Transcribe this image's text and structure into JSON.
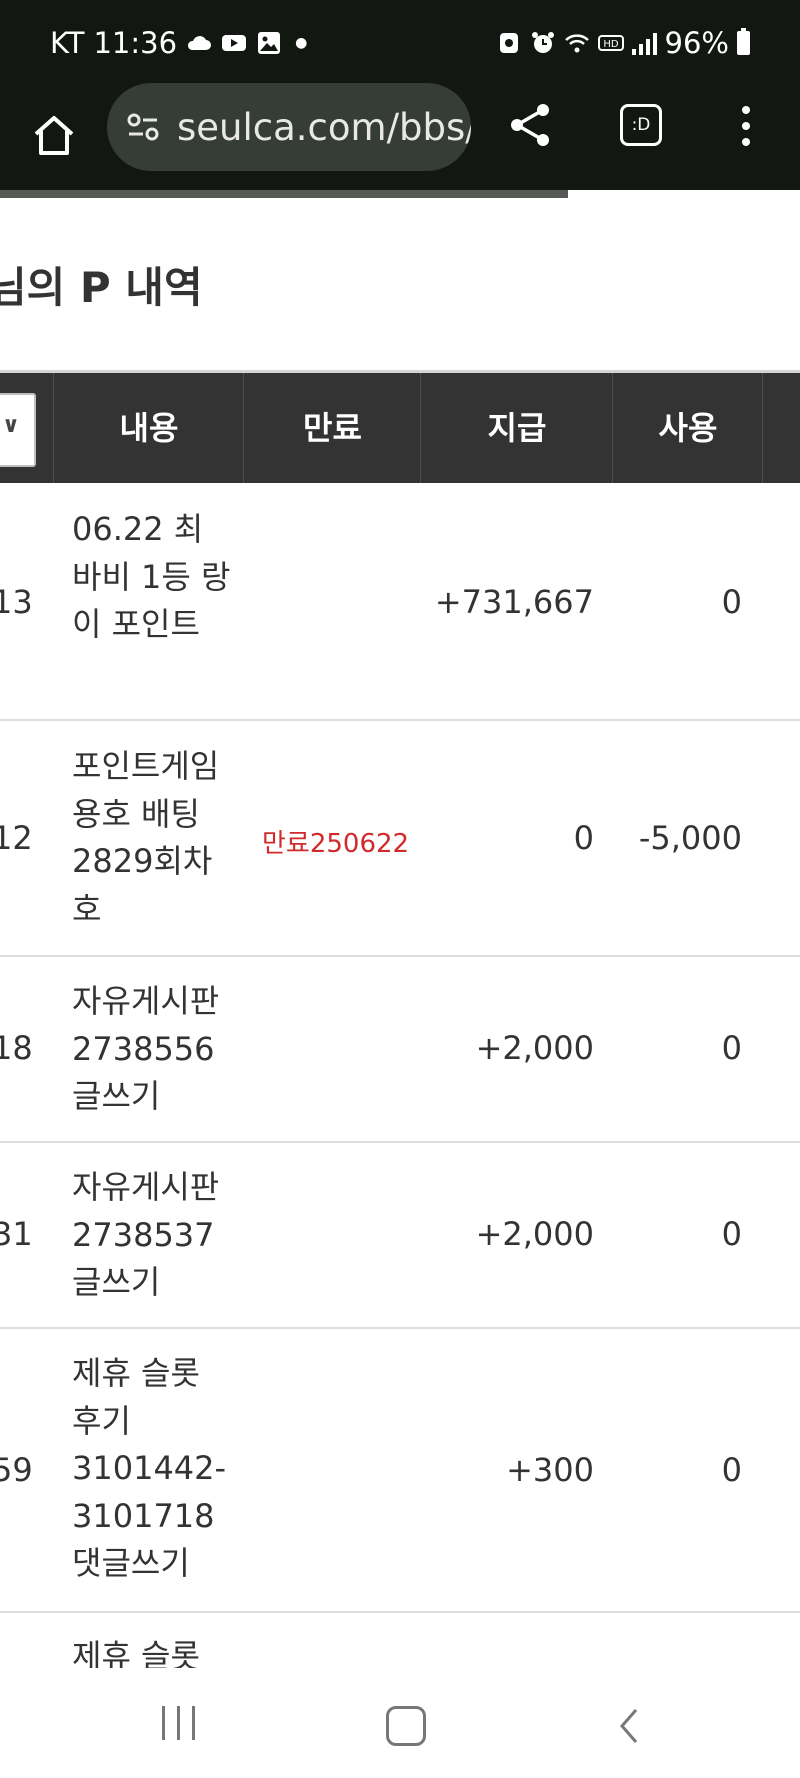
{
  "status_bar": {
    "carrier": "KT",
    "time": "11:36",
    "battery": "96%",
    "icons_left": [
      "cloud-icon",
      "youtube-icon",
      "gallery-icon"
    ],
    "icons_right": [
      "vpn-icon",
      "alarm-icon",
      "wifi-icon",
      "hd-icon",
      "signal-icon",
      "battery-icon"
    ]
  },
  "browser": {
    "url": "seulca.com/bbs/",
    "tabs_label": ":D",
    "page_load_progress": 0.71
  },
  "page": {
    "title": "님의 P 내역"
  },
  "table": {
    "headers": {
      "content": "내용",
      "expire": "만료",
      "pay": "지급",
      "use": "사용"
    },
    "rows": [
      {
        "no": "13",
        "content": "06.22 최바비 1등 랑이 포인트",
        "expire": "",
        "pay": "+731,667",
        "use": "0"
      },
      {
        "no": "12",
        "content": "포인트게임 용호 배팅 2829회차 호",
        "expire": "만료250622",
        "pay": "0",
        "use": "-5,000"
      },
      {
        "no": "18",
        "content": "자유게시판 2738556 글쓰기",
        "expire": "",
        "pay": "+2,000",
        "use": "0"
      },
      {
        "no": "31",
        "content": "자유게시판 2738537 글쓰기",
        "expire": "",
        "pay": "+2,000",
        "use": "0"
      },
      {
        "no": "59",
        "content": "제휴 슬롯 후기 3101442-3101718 댓글쓰기",
        "expire": "",
        "pay": "+300",
        "use": "0"
      },
      {
        "no": "",
        "content": "제휴 슬롯",
        "expire": "",
        "pay": "",
        "use": ""
      }
    ]
  },
  "colors": {
    "status_bg": "#121712",
    "table_header_bg": "#333333",
    "expire_text": "#d12a2a"
  }
}
